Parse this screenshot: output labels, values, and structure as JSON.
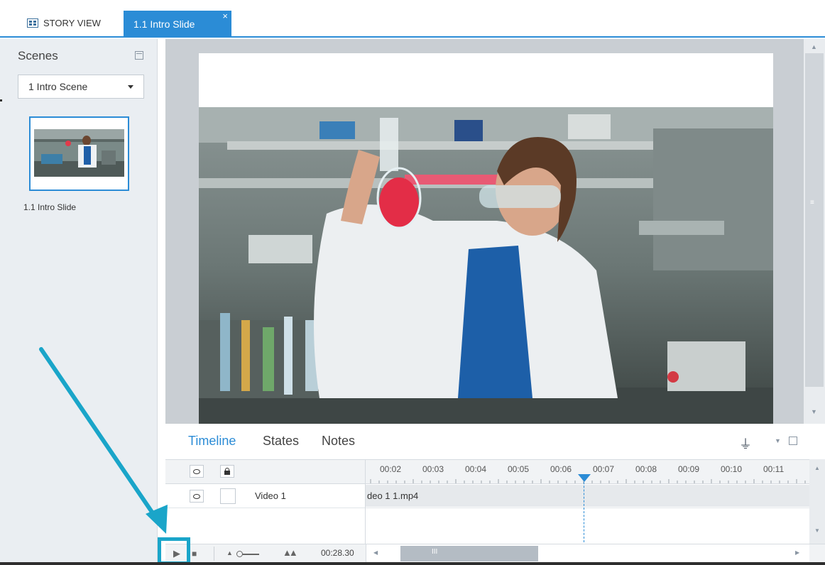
{
  "tabs": {
    "story_view": "STORY VIEW",
    "active": "1.1 Intro Slide",
    "close": "×"
  },
  "scenes": {
    "title": "Scenes",
    "selected_scene": "1 Intro Scene",
    "thumbnail_label": "1.1 Intro Slide"
  },
  "timeline": {
    "tabs": [
      "Timeline",
      "States",
      "Notes"
    ],
    "time_labels": [
      "00:02",
      "00:03",
      "00:04",
      "00:05",
      "00:06",
      "00:07",
      "00:08",
      "00:09",
      "00:10",
      "00:11"
    ],
    "layer_name": "Video 1",
    "clip_label": "deo 1 1.mp4",
    "duration": "00:28.30"
  },
  "colors": {
    "accent": "#2b8cd6",
    "annotation": "#1aa5c9"
  }
}
